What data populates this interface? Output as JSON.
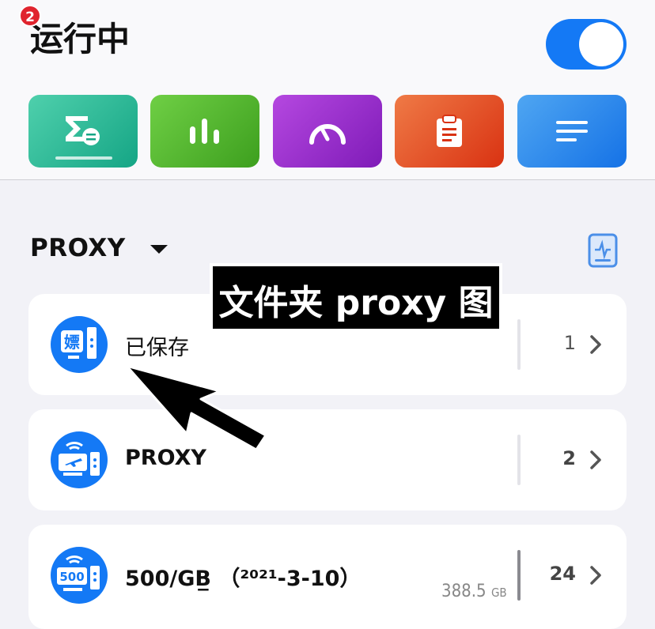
{
  "header": {
    "title": "运行中",
    "badge_count": "2",
    "toggle_on": true
  },
  "toolbar": [
    {
      "name": "overview",
      "icon": "sigma-list-icon",
      "color": "#15a585"
    },
    {
      "name": "stats",
      "icon": "bar-chart-icon",
      "color": "#3d9f1e"
    },
    {
      "name": "speed",
      "icon": "speedometer-icon",
      "color": "#7f1bb8"
    },
    {
      "name": "clipboard",
      "icon": "clipboard-icon",
      "color": "#d93212"
    },
    {
      "name": "menu",
      "icon": "lines-icon",
      "color": "#1572e6"
    }
  ],
  "section": {
    "label": "PROXY",
    "right_icon": "document-pulse-icon"
  },
  "overlay": {
    "text": "文件夹 proxy 图"
  },
  "cards": [
    {
      "name": "已保存",
      "count": "1",
      "avatar_text": "嫖"
    },
    {
      "name": "PROXY",
      "count": "2"
    },
    {
      "name": "500/GB̲ （²⁰²¹-3-10）",
      "count": "24",
      "size": "388.5",
      "size_unit": "GB",
      "avatar_text": "500"
    }
  ]
}
